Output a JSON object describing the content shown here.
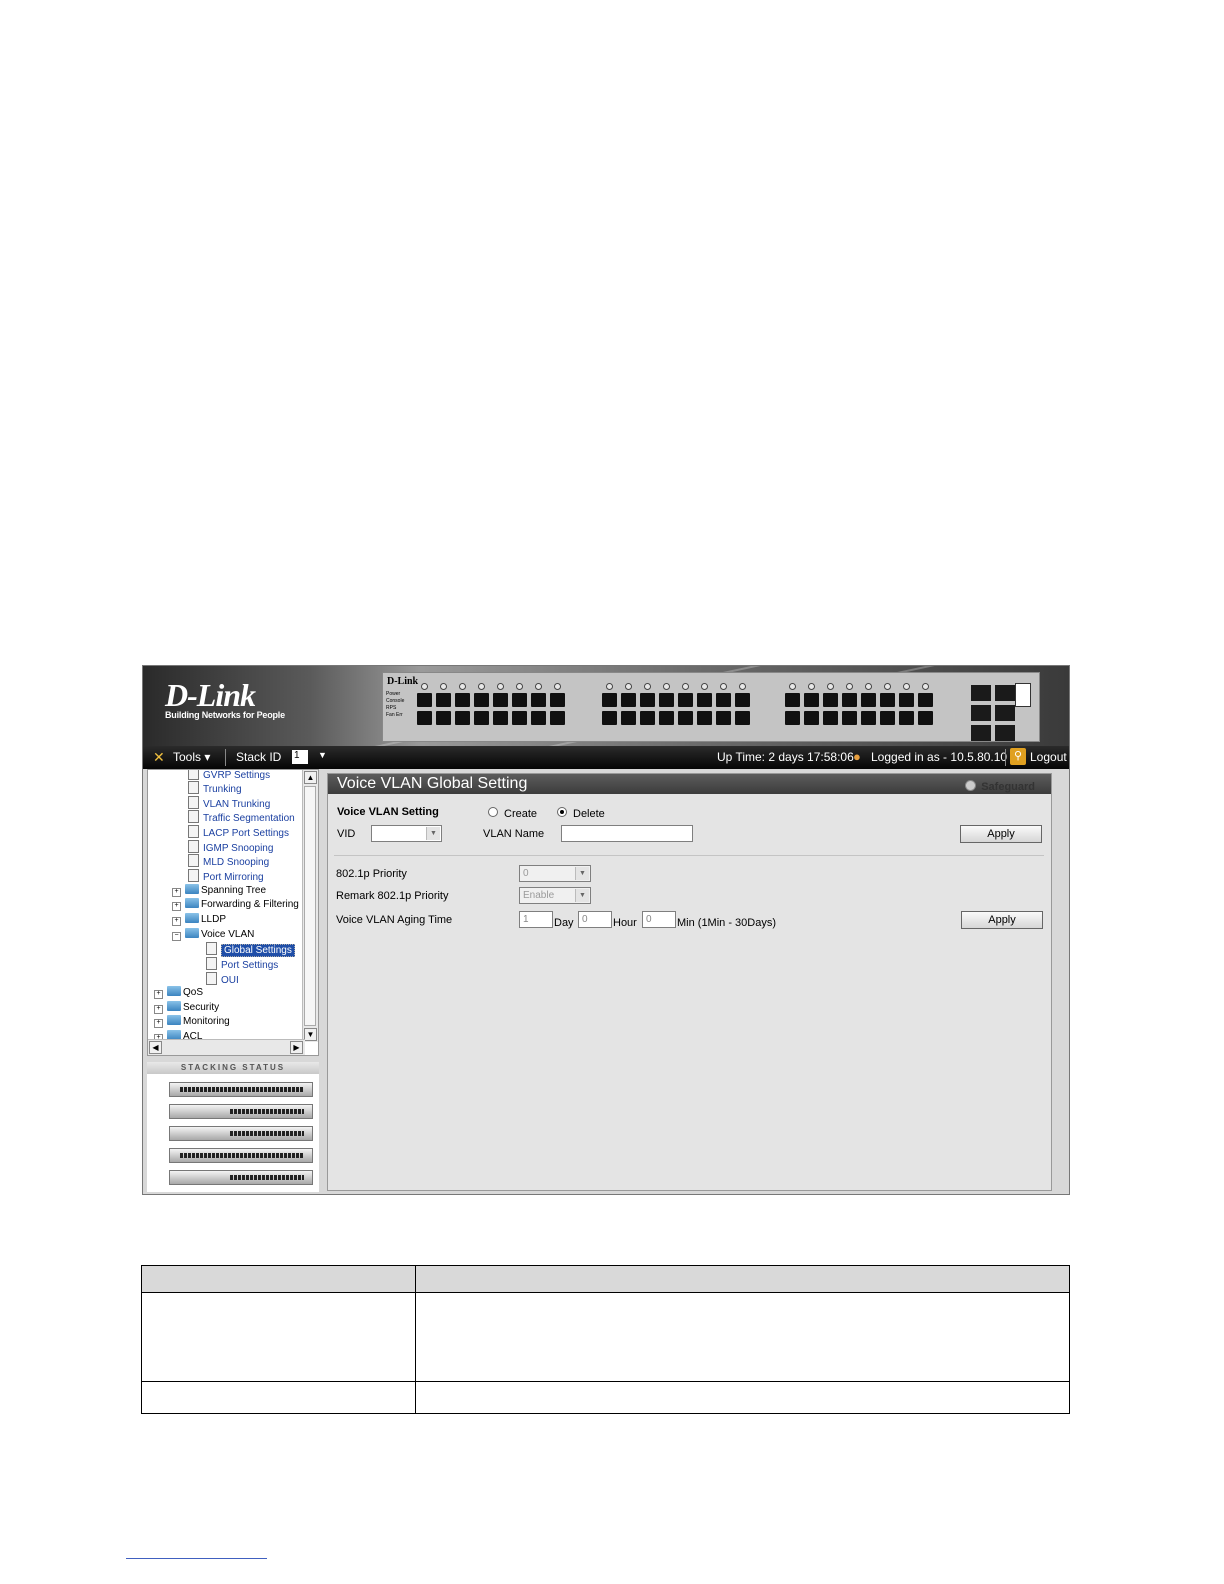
{
  "brand": {
    "name": "D-Link",
    "tagline": "Building Networks for People",
    "device_brand": "D-Link",
    "device_leds": [
      "Power",
      "Console",
      "RPS",
      "Fan Err"
    ]
  },
  "toolbar": {
    "tools_label": "Tools",
    "stack_id_label": "Stack ID",
    "stack_id_value": "1",
    "uptime": "Up Time: 2 days 17:58:06",
    "logged_in": "Logged in as - 10.5.80.10",
    "logout_label": "Logout"
  },
  "tree": {
    "items": [
      {
        "label": "GVRP Settings",
        "type": "doc"
      },
      {
        "label": "Trunking",
        "type": "doc"
      },
      {
        "label": "VLAN Trunking",
        "type": "doc"
      },
      {
        "label": "Traffic Segmentation",
        "type": "doc"
      },
      {
        "label": "LACP Port Settings",
        "type": "doc"
      },
      {
        "label": "IGMP Snooping",
        "type": "doc"
      },
      {
        "label": "MLD Snooping",
        "type": "doc"
      },
      {
        "label": "Port Mirroring",
        "type": "doc"
      },
      {
        "label": "Spanning Tree",
        "type": "folder"
      },
      {
        "label": "Forwarding & Filtering",
        "type": "folder"
      },
      {
        "label": "LLDP",
        "type": "folder"
      },
      {
        "label": "Voice VLAN",
        "type": "folder-open"
      },
      {
        "label": "Global Settings",
        "type": "doc",
        "selected": true
      },
      {
        "label": "Port Settings",
        "type": "doc"
      },
      {
        "label": "OUI",
        "type": "doc"
      },
      {
        "label": "QoS",
        "type": "folder"
      },
      {
        "label": "Security",
        "type": "folder"
      },
      {
        "label": "Monitoring",
        "type": "folder"
      },
      {
        "label": "ACL",
        "type": "folder"
      }
    ]
  },
  "stacking": {
    "title": "Stacking Status",
    "units": 5
  },
  "main": {
    "title": "Voice VLAN Global Setting",
    "safeguard": "Safeguard",
    "section_label": "Voice VLAN Setting",
    "radio_create": "Create",
    "radio_delete": "Delete",
    "radio_selected": "Delete",
    "vid_label": "VID",
    "vid_value": "",
    "vlan_name_label": "VLAN Name",
    "vlan_name_value": "",
    "apply_label": "Apply",
    "priority_label": "802.1p Priority",
    "priority_value": "0",
    "remark_label": "Remark 802.1p Priority",
    "remark_value": "Enable",
    "aging_label": "Voice VLAN Aging Time",
    "aging_day_value": "1",
    "day_label": "Day",
    "aging_hour_value": "0",
    "hour_label": "Hour",
    "aging_min_value": "0",
    "min_label": "Min (1Min - 30Days)",
    "apply2_label": "Apply"
  }
}
